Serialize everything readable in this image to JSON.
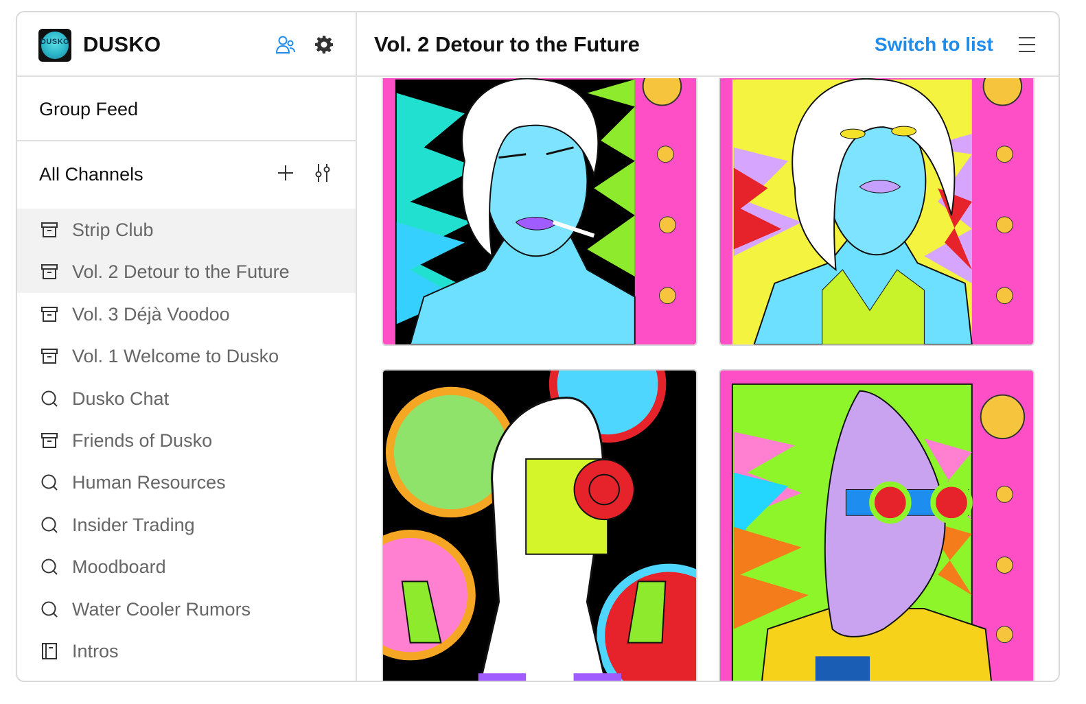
{
  "app": {
    "name": "DUSKO",
    "logo_text": "DUSKO",
    "brand_color": "#1f8ceb"
  },
  "sidebar": {
    "group_feed_label": "Group Feed",
    "channels_title": "All Channels",
    "channels": [
      {
        "label": "Strip Club",
        "icon": "archive-icon",
        "active": true
      },
      {
        "label": "Vol. 2 Detour to the Future",
        "icon": "archive-icon",
        "active": true
      },
      {
        "label": "Vol. 3 Déjà Voodoo",
        "icon": "archive-icon",
        "active": false
      },
      {
        "label": "Vol. 1 Welcome to Dusko",
        "icon": "archive-icon",
        "active": false
      },
      {
        "label": "Dusko Chat",
        "icon": "chat-bubble-icon",
        "active": false
      },
      {
        "label": "Friends of Dusko",
        "icon": "archive-icon",
        "active": false
      },
      {
        "label": "Human Resources",
        "icon": "chat-bubble-icon",
        "active": false
      },
      {
        "label": "Insider Trading",
        "icon": "chat-bubble-icon",
        "active": false
      },
      {
        "label": "Moodboard",
        "icon": "chat-bubble-icon",
        "active": false
      },
      {
        "label": "Water Cooler Rumors",
        "icon": "chat-bubble-icon",
        "active": false
      },
      {
        "label": "Intros",
        "icon": "notebook-icon",
        "active": false
      }
    ]
  },
  "main": {
    "channel_title": "Vol. 2 Detour to the Future",
    "switch_label": "Switch to list"
  },
  "gallery": {
    "items": [
      {
        "name": "blue-woman-smoking-artwork"
      },
      {
        "name": "blue-woman-yellow-eyes-artwork"
      },
      {
        "name": "white-robot-clocks-artwork"
      },
      {
        "name": "purple-figure-goggles-artwork"
      }
    ]
  }
}
